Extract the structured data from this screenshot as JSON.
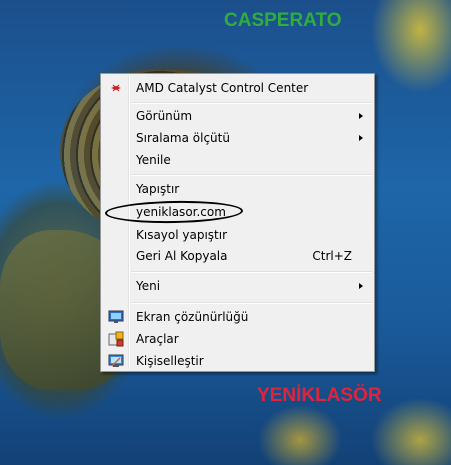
{
  "watermarks": {
    "top": "CASPERATO",
    "bottom": "YENİKLASÖR"
  },
  "menu": {
    "amd": {
      "label": "AMD Catalyst Control Center",
      "icon": "amd-icon"
    },
    "view": "Görünüm",
    "sort": "Sıralama ölçütü",
    "refresh": "Yenile",
    "paste": "Yapıştır",
    "site": "yeniklasor.com",
    "paste_shortcut": "Kısayol yapıştır",
    "undo": {
      "label": "Geri Al Kopyala",
      "shortcut": "Ctrl+Z"
    },
    "new": "Yeni",
    "resolution": {
      "label": "Ekran çözünürlüğü",
      "icon": "display-icon"
    },
    "gadgets": {
      "label": "Araçlar",
      "icon": "gadgets-icon"
    },
    "personalize": {
      "label": "Kişiselleştir",
      "icon": "personalize-icon"
    }
  },
  "colors": {
    "watermark_top": "#2fae3f",
    "watermark_bottom": "#e0243c",
    "menu_bg": "#f0f0f0"
  }
}
